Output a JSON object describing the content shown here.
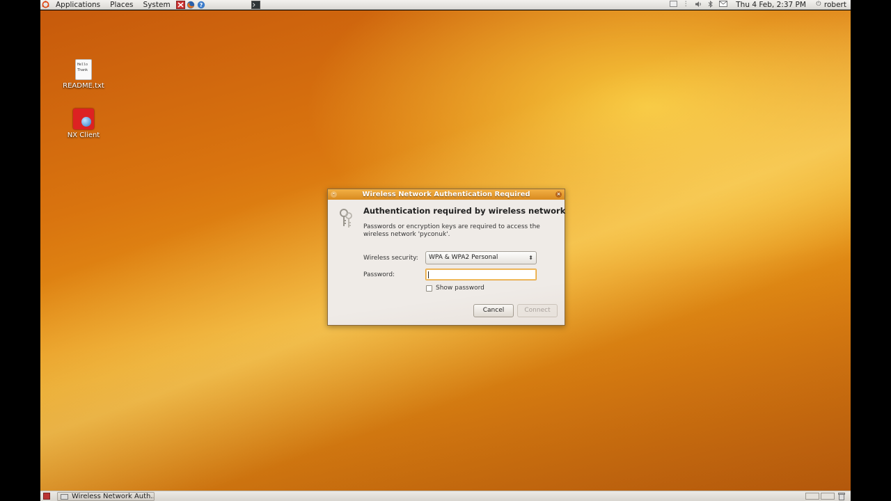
{
  "top_panel": {
    "menus": [
      "Applications",
      "Places",
      "System"
    ],
    "clock": "Thu 4 Feb, 2:37 PM",
    "user": "robert"
  },
  "desktop": {
    "icons": [
      {
        "label": "README.txt",
        "preview": [
          "Hello",
          "Thank"
        ],
        "icon": "text-file-icon"
      },
      {
        "label": "NX Client",
        "icon": "nx-client-icon"
      }
    ]
  },
  "dialog": {
    "title": "Wireless Network Authentication Required",
    "heading": "Authentication required by wireless network",
    "description": "Passwords or encryption keys are required to access the wireless network 'pyconuk'.",
    "security_label": "Wireless security:",
    "security_value": "WPA & WPA2 Personal",
    "password_label": "Password:",
    "password_value": "",
    "show_password_label": "Show password",
    "show_password_checked": false,
    "cancel_label": "Cancel",
    "connect_label": "Connect"
  },
  "bottom_panel": {
    "task_label": "Wireless Network Auth..."
  }
}
